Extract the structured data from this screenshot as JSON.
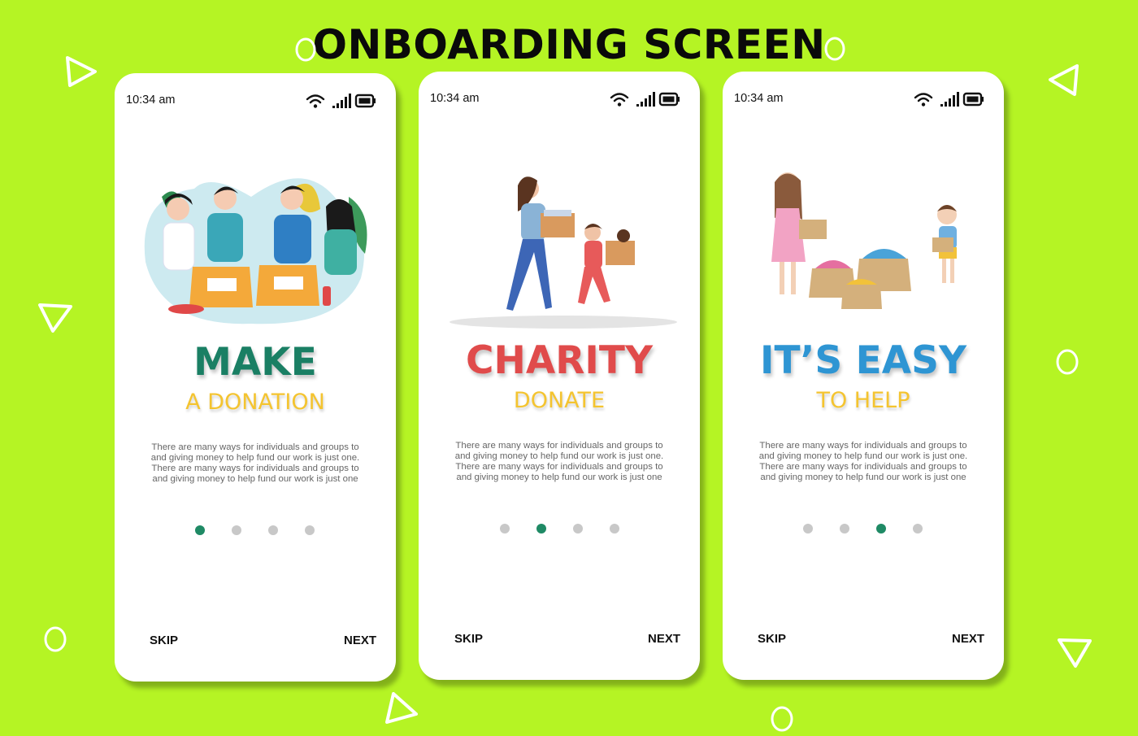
{
  "header": {
    "title": "ONBOARDING SCREEN"
  },
  "colors": {
    "background": "#b5f424",
    "accent_active_dot": "#1f8a65",
    "inactive_dot": "#c8c8c8",
    "subtitle": "#f4c430"
  },
  "screens": [
    {
      "status": {
        "time": "10:34 am",
        "icons": [
          "wifi-icon",
          "signal-icon",
          "battery-icon"
        ]
      },
      "illustration": "volunteers-donation-boxes",
      "title": "MAKE",
      "title_color": "#1a7f64",
      "subtitle": "A DONATION",
      "body_lines": [
        "There are many ways for individuals and groups to",
        "and giving money to help fund our work is just one.",
        "There are many ways for individuals and groups to",
        "and giving money to help fund our work is just one"
      ],
      "active_page": 1,
      "total_pages": 4,
      "skip_label": "SKIP",
      "next_label": "NEXT"
    },
    {
      "status": {
        "time": "10:34 am",
        "icons": [
          "wifi-icon",
          "signal-icon",
          "battery-icon"
        ]
      },
      "illustration": "woman-and-girl-carrying-boxes",
      "title": "CHARITY",
      "title_color": "#e04b4b",
      "subtitle": "DONATE",
      "body_lines": [
        "There are many ways for individuals and groups to",
        "and giving money to help fund our work is just one.",
        "There are many ways for individuals and groups to",
        "and giving money to help fund our work is just one"
      ],
      "active_page": 2,
      "total_pages": 4,
      "skip_label": "SKIP",
      "next_label": "NEXT"
    },
    {
      "status": {
        "time": "10:34 am",
        "icons": [
          "wifi-icon",
          "signal-icon",
          "battery-icon"
        ]
      },
      "illustration": "girl-and-boy-with-clothes-boxes",
      "title": "IT’S EASY",
      "title_color": "#2e95d3",
      "subtitle": "TO HELP",
      "body_lines": [
        "There are many ways for individuals and groups to",
        "and giving money to help fund our work is just one.",
        "There are many ways for individuals and groups to",
        "and giving money to help fund our work is just one"
      ],
      "active_page": 3,
      "total_pages": 4,
      "skip_label": "SKIP",
      "next_label": "NEXT"
    }
  ]
}
